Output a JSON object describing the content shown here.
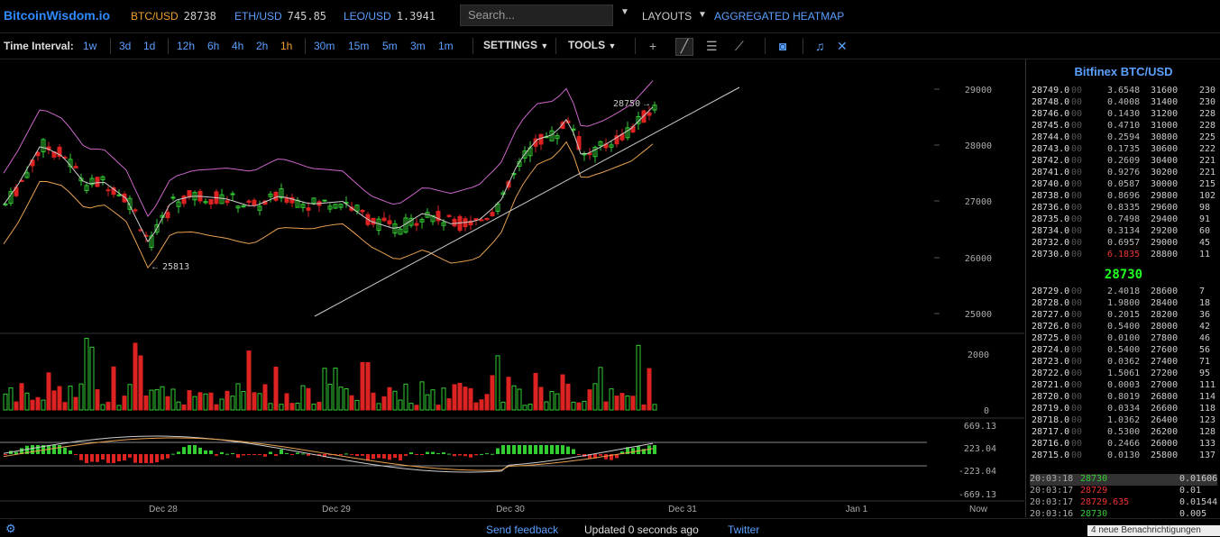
{
  "header": {
    "logo": "BitcoinWisdom.io",
    "tickers": [
      {
        "symbol": "BTC/USD",
        "price": "28738"
      },
      {
        "symbol": "ETH/USD",
        "price": "745.85"
      },
      {
        "symbol": "LEO/USD",
        "price": "1.3941"
      }
    ],
    "search_placeholder": "Search...",
    "layouts_label": "LAYOUTS",
    "heatmap_label": "AGGREGATED HEATMAP"
  },
  "toolbar": {
    "time_interval_label": "Time Interval:",
    "intervals": [
      "1w",
      "3d",
      "1d",
      "12h",
      "6h",
      "4h",
      "2h",
      "1h",
      "30m",
      "15m",
      "5m",
      "3m",
      "1m"
    ],
    "active_interval": "1h",
    "settings_label": "SETTINGS",
    "tools_label": "TOOLS"
  },
  "chart": {
    "price_axis": [
      "29000",
      "28000",
      "27000",
      "26000",
      "25000"
    ],
    "volume_axis": [
      "2000",
      "0"
    ],
    "macd_axis": [
      "669.13",
      "223.04",
      "-223.04",
      "-669.13"
    ],
    "time_axis": [
      "Dec 28",
      "Dec 29",
      "Dec 30",
      "Dec 31",
      "Jan 1",
      "Now"
    ],
    "high_label": "28750",
    "low_label": "25813",
    "colors": {
      "up": "#33cc33",
      "down": "#dd2222",
      "bb": "#cc66cc",
      "ma": "#cccccc",
      "orange": "#e8a050"
    }
  },
  "orderbook": {
    "title": "Bitfinex BTC/USD",
    "asks": [
      {
        "price": "28749.0",
        "dec": "00",
        "amount": "3.6548",
        "total": "31600",
        "sum": "230"
      },
      {
        "price": "28748.0",
        "dec": "00",
        "amount": "0.4008",
        "total": "31400",
        "sum": "230"
      },
      {
        "price": "28746.0",
        "dec": "00",
        "amount": "0.1430",
        "total": "31200",
        "sum": "228"
      },
      {
        "price": "28745.0",
        "dec": "00",
        "amount": "0.4710",
        "total": "31000",
        "sum": "228"
      },
      {
        "price": "28744.0",
        "dec": "00",
        "amount": "0.2594",
        "total": "30800",
        "sum": "225"
      },
      {
        "price": "28743.0",
        "dec": "00",
        "amount": "0.1735",
        "total": "30600",
        "sum": "222"
      },
      {
        "price": "28742.0",
        "dec": "00",
        "amount": "0.2609",
        "total": "30400",
        "sum": "221"
      },
      {
        "price": "28741.0",
        "dec": "00",
        "amount": "0.9276",
        "total": "30200",
        "sum": "221"
      },
      {
        "price": "28740.0",
        "dec": "00",
        "amount": "0.0587",
        "total": "30000",
        "sum": "215"
      },
      {
        "price": "28738.0",
        "dec": "00",
        "amount": "0.8696",
        "total": "29800",
        "sum": "102"
      },
      {
        "price": "28736.0",
        "dec": "00",
        "amount": "0.8335",
        "total": "29600",
        "sum": "98"
      },
      {
        "price": "28735.0",
        "dec": "00",
        "amount": "0.7498",
        "total": "29400",
        "sum": "91"
      },
      {
        "price": "28734.0",
        "dec": "00",
        "amount": "0.3134",
        "total": "29200",
        "sum": "60"
      },
      {
        "price": "28732.0",
        "dec": "00",
        "amount": "0.6957",
        "total": "29000",
        "sum": "45"
      },
      {
        "price": "28730.0",
        "dec": "00",
        "amount": "6.1835",
        "total": "28800",
        "sum": "11"
      }
    ],
    "mid_price": "28730",
    "bids": [
      {
        "price": "28729.0",
        "dec": "00",
        "amount": "2.4018",
        "total": "28600",
        "sum": "7"
      },
      {
        "price": "28728.0",
        "dec": "00",
        "amount": "1.9800",
        "total": "28400",
        "sum": "18"
      },
      {
        "price": "28727.0",
        "dec": "00",
        "amount": "0.2015",
        "total": "28200",
        "sum": "36"
      },
      {
        "price": "28726.0",
        "dec": "00",
        "amount": "0.5400",
        "total": "28000",
        "sum": "42"
      },
      {
        "price": "28725.0",
        "dec": "00",
        "amount": "0.0100",
        "total": "27800",
        "sum": "46"
      },
      {
        "price": "28724.0",
        "dec": "00",
        "amount": "0.5400",
        "total": "27600",
        "sum": "56"
      },
      {
        "price": "28723.0",
        "dec": "00",
        "amount": "0.0362",
        "total": "27400",
        "sum": "71"
      },
      {
        "price": "28722.0",
        "dec": "00",
        "amount": "1.5061",
        "total": "27200",
        "sum": "95"
      },
      {
        "price": "28721.0",
        "dec": "00",
        "amount": "0.0003",
        "total": "27000",
        "sum": "111"
      },
      {
        "price": "28720.0",
        "dec": "00",
        "amount": "0.8019",
        "total": "26800",
        "sum": "114"
      },
      {
        "price": "28719.0",
        "dec": "00",
        "amount": "0.0334",
        "total": "26600",
        "sum": "118"
      },
      {
        "price": "28718.0",
        "dec": "00",
        "amount": "1.0362",
        "total": "26400",
        "sum": "123"
      },
      {
        "price": "28717.0",
        "dec": "00",
        "amount": "0.5300",
        "total": "26200",
        "sum": "128"
      },
      {
        "price": "28716.0",
        "dec": "00",
        "amount": "0.2466",
        "total": "26000",
        "sum": "133"
      },
      {
        "price": "28715.0",
        "dec": "00",
        "amount": "0.0130",
        "total": "25800",
        "sum": "137"
      }
    ],
    "trades": [
      {
        "time": "20:03:18",
        "price": "28730",
        "amount": "0.01606"
      },
      {
        "time": "20:03:17",
        "price": "28729",
        "amount": "0.01"
      },
      {
        "time": "20:03:17",
        "price": "28729.635",
        "amount": "0.01544"
      },
      {
        "time": "20:03:16",
        "price": "28730",
        "amount": "0.005"
      }
    ]
  },
  "footer": {
    "feedback": "Send feedback",
    "updated": "Updated 0 seconds ago",
    "twitter": "Twitter",
    "notification": "4 neue Benachrichtigungen"
  }
}
